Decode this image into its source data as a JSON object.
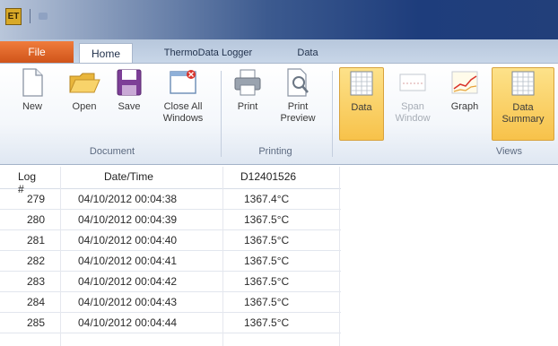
{
  "titlebar": {
    "app_icon_text": "ET"
  },
  "tabs": {
    "file": "File",
    "home": "Home",
    "thermodata_logger": "ThermoData Logger",
    "data": "Data"
  },
  "ribbon": {
    "document": {
      "label": "Document",
      "new": "New",
      "open": "Open",
      "save": "Save",
      "close_all": "Close All\nWindows"
    },
    "printing": {
      "label": "Printing",
      "print": "Print",
      "print_preview": "Print\nPreview"
    },
    "views": {
      "label": "Views",
      "data": "Data",
      "span_window": "Span\nWindow",
      "graph": "Graph",
      "data_summary": "Data\nSummary"
    }
  },
  "table": {
    "headers": {
      "log": "Log #",
      "datetime": "Date/Time",
      "value": "D12401526"
    },
    "rows": [
      {
        "log": "279",
        "datetime": "04/10/2012 00:04:38",
        "value": "1367.4°C"
      },
      {
        "log": "280",
        "datetime": "04/10/2012 00:04:39",
        "value": "1367.5°C"
      },
      {
        "log": "281",
        "datetime": "04/10/2012 00:04:40",
        "value": "1367.5°C"
      },
      {
        "log": "282",
        "datetime": "04/10/2012 00:04:41",
        "value": "1367.5°C"
      },
      {
        "log": "283",
        "datetime": "04/10/2012 00:04:42",
        "value": "1367.5°C"
      },
      {
        "log": "284",
        "datetime": "04/10/2012 00:04:43",
        "value": "1367.5°C"
      },
      {
        "log": "285",
        "datetime": "04/10/2012 00:04:44",
        "value": "1367.5°C"
      }
    ]
  },
  "colors": {
    "file_tab": "#e0632a",
    "active_button": "#f7c24a",
    "titlebar_dark": "#1e3d7c"
  },
  "icons": [
    "app-icon",
    "new-document-icon",
    "open-folder-icon",
    "save-disk-icon",
    "close-all-windows-icon",
    "printer-icon",
    "print-preview-icon",
    "data-grid-icon",
    "span-window-icon",
    "graph-icon",
    "data-summary-icon"
  ]
}
